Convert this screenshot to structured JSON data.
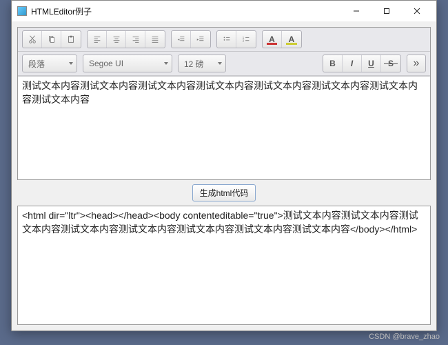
{
  "window": {
    "title": "HTMLEditor例子"
  },
  "toolbar": {
    "paragraph_select": "段落",
    "font_select": "Segoe UI",
    "size_select": "12 磅",
    "bold": "B",
    "italic": "I",
    "underline": "U",
    "strike": "S",
    "more": "»"
  },
  "editor": {
    "text": "测试文本内容测试文本内容测试文本内容测试文本内容测试文本内容测试文本内容测试文本内容测试文本内容"
  },
  "button": {
    "generate": "生成html代码"
  },
  "output": {
    "text": "<html dir=\"ltr\"><head></head><body contenteditable=\"true\">测试文本内容测试文本内容测试文本内容测试文本内容测试文本内容测试文本内容测试文本内容测试文本内容</body></html>"
  },
  "watermark": "CSDN @brave_zhao"
}
